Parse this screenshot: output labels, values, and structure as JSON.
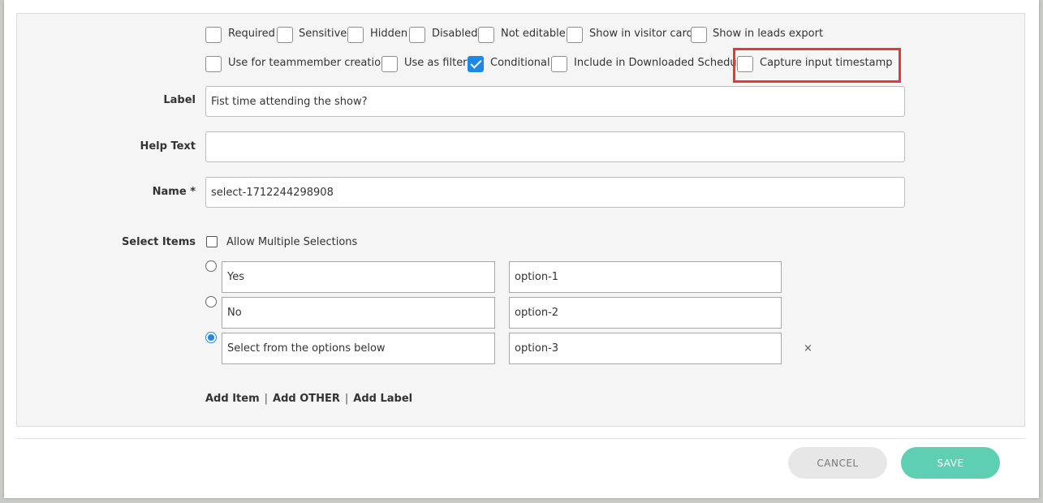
{
  "options": [
    {
      "label": "Required",
      "checked": false
    },
    {
      "label": "Sensitive",
      "checked": false
    },
    {
      "label": "Hidden",
      "checked": false
    },
    {
      "label": "Disabled",
      "checked": false
    },
    {
      "label": "Not editable",
      "checked": false
    },
    {
      "label": "Show in visitor card",
      "checked": false
    },
    {
      "label": "Show in leads export",
      "checked": false
    },
    {
      "label": "Use for teammember creation",
      "checked": false
    },
    {
      "label": "Use as filter",
      "checked": false
    },
    {
      "label": "Conditional",
      "checked": true
    },
    {
      "label": "Include in Downloaded Schedule",
      "checked": false
    },
    {
      "label": "Capture input timestamp",
      "checked": false
    }
  ],
  "fields": {
    "label": {
      "label": "Label",
      "value": "Fist time attending the show?"
    },
    "help_text": {
      "label": "Help Text",
      "value": ""
    },
    "name": {
      "label": "Name *",
      "value": "select-1712244298908"
    }
  },
  "select_items": {
    "label": "Select Items",
    "allow_multiple_label": "Allow Multiple Selections",
    "allow_multiple_checked": false,
    "items": [
      {
        "text": "Yes",
        "value": "option-1",
        "selected": false
      },
      {
        "text": "No",
        "value": "option-2",
        "selected": false
      },
      {
        "text": "Select from the options below",
        "value": "option-3",
        "selected": true,
        "remove_icon": "×"
      }
    ]
  },
  "add_links": {
    "add_item": "Add Item",
    "add_other": "Add OTHER",
    "add_label": "Add Label",
    "separator": "|"
  },
  "footer": {
    "cancel": "CANCEL",
    "save": "SAVE"
  },
  "colors": {
    "accent": "#1e88e5",
    "save": "#5fcfb3",
    "highlight": "#e53935"
  }
}
